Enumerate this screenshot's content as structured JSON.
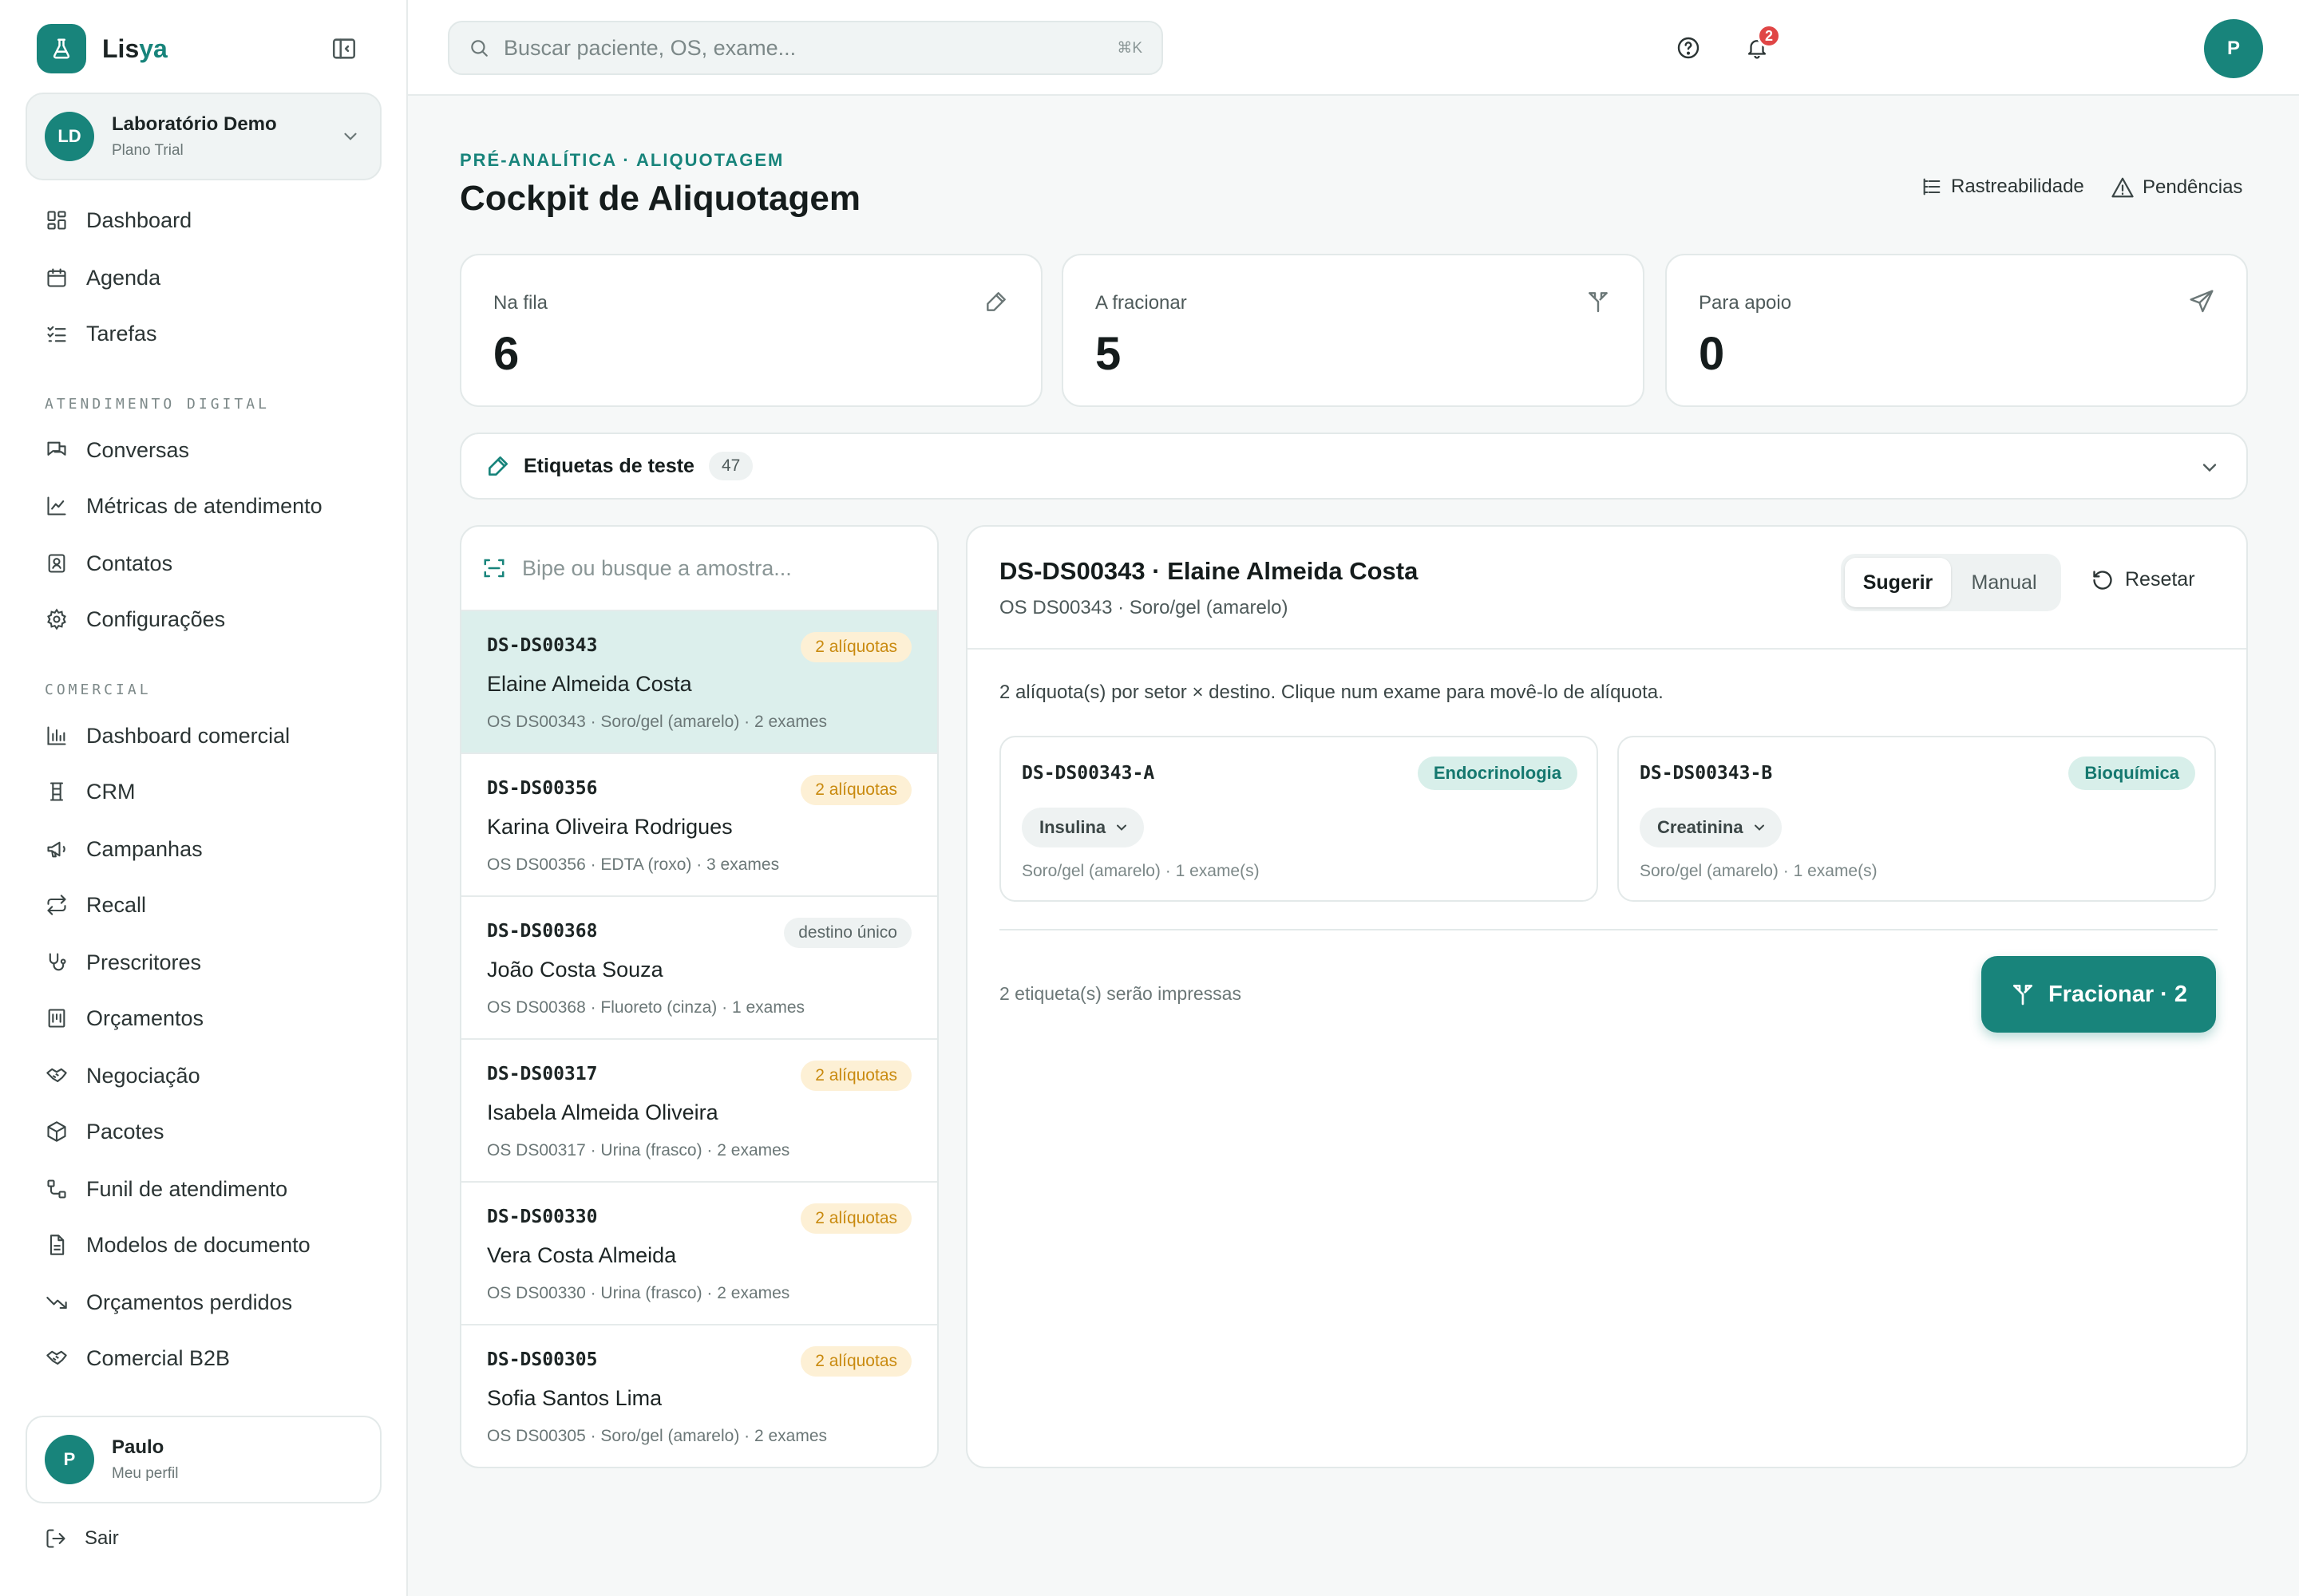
{
  "brand": {
    "name_main": "Lis",
    "name_accent": "ya"
  },
  "org": {
    "initials": "LD",
    "name": "Laboratório Demo",
    "plan": "Plano Trial"
  },
  "nav": {
    "main": [
      {
        "label": "Dashboard",
        "icon": "dashboard-icon"
      },
      {
        "label": "Agenda",
        "icon": "calendar-icon"
      },
      {
        "label": "Tarefas",
        "icon": "tasks-icon"
      }
    ],
    "section_digital": "ATENDIMENTO DIGITAL",
    "digital": [
      {
        "label": "Conversas",
        "icon": "chat-icon"
      },
      {
        "label": "Métricas de atendimento",
        "icon": "line-chart-icon"
      },
      {
        "label": "Contatos",
        "icon": "contacts-icon"
      },
      {
        "label": "Configurações",
        "icon": "gear-icon"
      }
    ],
    "section_comercial": "COMERCIAL",
    "comercial": [
      {
        "label": "Dashboard comercial",
        "icon": "bar-chart-icon"
      },
      {
        "label": "CRM",
        "icon": "crm-icon"
      },
      {
        "label": "Campanhas",
        "icon": "megaphone-icon"
      },
      {
        "label": "Recall",
        "icon": "repeat-icon"
      },
      {
        "label": "Prescritores",
        "icon": "stethoscope-icon"
      },
      {
        "label": "Orçamentos",
        "icon": "receipt-icon"
      },
      {
        "label": "Negociação",
        "icon": "handshake-icon"
      },
      {
        "label": "Pacotes",
        "icon": "package-icon"
      },
      {
        "label": "Funil de atendimento",
        "icon": "funnel-icon"
      },
      {
        "label": "Modelos de documento",
        "icon": "document-icon"
      },
      {
        "label": "Orçamentos perdidos",
        "icon": "trend-down-icon"
      },
      {
        "label": "Comercial B2B",
        "icon": "handshake-icon"
      }
    ]
  },
  "user": {
    "initial": "P",
    "name": "Paulo",
    "sub": "Meu perfil"
  },
  "logout_label": "Sair",
  "topbar": {
    "search_placeholder": "Buscar paciente, OS, exame...",
    "search_shortcut": "⌘K",
    "notifications_count": "2",
    "avatar_initial": "P"
  },
  "page": {
    "eyebrow": "PRÉ-ANALÍTICA · ALIQUOTAGEM",
    "title": "Cockpit de Aliquotagem",
    "link_trace": "Rastreabilidade",
    "link_pending": "Pendências"
  },
  "stats": [
    {
      "label": "Na fila",
      "value": "6",
      "icon": "pipette-icon"
    },
    {
      "label": "A fracionar",
      "value": "5",
      "icon": "split-icon"
    },
    {
      "label": "Para apoio",
      "value": "0",
      "icon": "send-icon"
    }
  ],
  "test_labels": {
    "title": "Etiquetas de teste",
    "count": "47"
  },
  "queue": {
    "search_placeholder": "Bipe ou busque a amostra...",
    "items": [
      {
        "code": "DS-DS00343",
        "name": "Elaine Almeida Costa",
        "meta": "OS DS00343 · Soro/gel (amarelo) · 2 exames",
        "badge": "2 alíquotas",
        "badge_type": "warn",
        "active": true
      },
      {
        "code": "DS-DS00356",
        "name": "Karina Oliveira Rodrigues",
        "meta": "OS DS00356 · EDTA (roxo) · 3 exames",
        "badge": "2 alíquotas",
        "badge_type": "warn"
      },
      {
        "code": "DS-DS00368",
        "name": "João Costa Souza",
        "meta": "OS DS00368 · Fluoreto (cinza) · 1 exames",
        "badge": "destino único",
        "badge_type": "neutral"
      },
      {
        "code": "DS-DS00317",
        "name": "Isabela Almeida Oliveira",
        "meta": "OS DS00317 · Urina (frasco) · 2 exames",
        "badge": "2 alíquotas",
        "badge_type": "warn"
      },
      {
        "code": "DS-DS00330",
        "name": "Vera Costa Almeida",
        "meta": "OS DS00330 · Urina (frasco) · 2 exames",
        "badge": "2 alíquotas",
        "badge_type": "warn"
      },
      {
        "code": "DS-DS00305",
        "name": "Sofia Santos Lima",
        "meta": "OS DS00305 · Soro/gel (amarelo) · 2 exames",
        "badge": "2 alíquotas",
        "badge_type": "warn"
      }
    ]
  },
  "detail": {
    "title": "DS-DS00343 · Elaine Almeida Costa",
    "subtitle": "OS DS00343 · Soro/gel (amarelo)",
    "mode_suggest": "Sugerir",
    "mode_manual": "Manual",
    "reset_label": "Resetar",
    "instruction": "2 alíquota(s) por setor × destino. Clique num exame para movê-lo de alíquota.",
    "aliquots": [
      {
        "code": "DS-DS00343-A",
        "sector": "Endocrinologia",
        "exam": "Insulina",
        "meta": "Soro/gel (amarelo) · 1 exame(s)"
      },
      {
        "code": "DS-DS00343-B",
        "sector": "Bioquímica",
        "exam": "Creatinina",
        "meta": "Soro/gel (amarelo) · 1 exame(s)"
      }
    ],
    "footer_note": "2 etiqueta(s) serão impressas",
    "action_label": "Fracionar · 2"
  },
  "colors": {
    "brand": "#18847b",
    "warn": "#c98a0f",
    "danger": "#e04646"
  }
}
